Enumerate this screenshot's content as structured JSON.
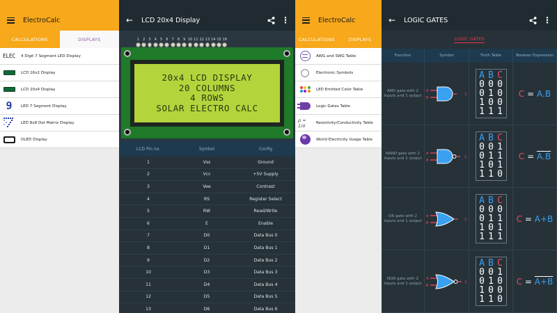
{
  "panel1": {
    "title": "ElectroCalc",
    "tabs": [
      "CALCULATIONS",
      "DISPLAYS"
    ],
    "items": [
      {
        "label": "4 Digit 7 Segment LED Display",
        "icon": "elec-text-icon",
        "icon_text": "ELEC"
      },
      {
        "label": "LCD 16x2 Display",
        "icon": "lcd-small-icon"
      },
      {
        "label": "LCD 20x4 Display",
        "icon": "lcd-small-icon"
      },
      {
        "label": "LED 7 Segment Display",
        "icon": "seven-segment-icon",
        "icon_text": "9"
      },
      {
        "label": "LED 8x8 Dot Matrix Display",
        "icon": "dot-matrix-icon"
      },
      {
        "label": "OLED Display",
        "icon": "oled-icon"
      }
    ]
  },
  "panel2": {
    "title": "LCD 20x4 Display",
    "pin_numbers": [
      "1",
      "2",
      "3",
      "4",
      "5",
      "6",
      "7",
      "8",
      "9",
      "10",
      "11",
      "12",
      "13",
      "14",
      "15",
      "16"
    ],
    "lcd_lines": [
      "20x4 LCD DISPLAY",
      "20 COLUMNS",
      "4 ROWS",
      "SOLAR ELECTRO CALC"
    ],
    "table_headers": [
      "LCD Pin no.",
      "Symbol",
      "Config"
    ],
    "rows": [
      [
        "1",
        "Vss",
        "Ground"
      ],
      [
        "2",
        "Vcc",
        "+5V Supply"
      ],
      [
        "3",
        "Vee",
        "Contrast"
      ],
      [
        "4",
        "RS",
        "Register Select"
      ],
      [
        "5",
        "RW",
        "Read/Write"
      ],
      [
        "6",
        "E",
        "Enable"
      ],
      [
        "7",
        "D0",
        "Data Bus 0"
      ],
      [
        "8",
        "D1",
        "Data Bus 1"
      ],
      [
        "9",
        "D2",
        "Data Bus 2"
      ],
      [
        "10",
        "D3",
        "Data Bus 3"
      ],
      [
        "11",
        "D4",
        "Data Bus 4"
      ],
      [
        "12",
        "D5",
        "Data Bus 5"
      ],
      [
        "13",
        "D6",
        "Data Bus 6"
      ]
    ]
  },
  "panel3": {
    "title": "ElectroCalc",
    "tabs": [
      "CALCULATIONS",
      "DISPLAYS"
    ],
    "items": [
      {
        "label": "AWG and SWG Table",
        "icon": "wire-gauge-icon"
      },
      {
        "label": "Electronic Symbols",
        "icon": "bulb-icon"
      },
      {
        "label": "LED Emitted Color Table",
        "icon": "color-dots-icon"
      },
      {
        "label": "Logic Gates Table",
        "icon": "logic-gate-icon"
      },
      {
        "label": "Resistivity/Conductivity Table",
        "icon": "resistivity-icon",
        "icon_text": "ρ = 1/σ"
      },
      {
        "label": "World Electricity Usage Table",
        "icon": "globe-icon"
      }
    ]
  },
  "panel4": {
    "title": "LOGIC GATES",
    "section_title": "LOGIC GATES",
    "headers": [
      "Function",
      "Symbol",
      "Truth Table",
      "Boolean Expression"
    ],
    "gates": [
      {
        "function": "AND gate with 2 inputs and 1 output",
        "truth_table": [
          "A",
          "B",
          "C",
          "0",
          "0",
          "0",
          "0",
          "1",
          "0",
          "1",
          "0",
          "0",
          "1",
          "1",
          "1"
        ],
        "expr": {
          "out": "C",
          "eq": "=",
          "expr": "A.B",
          "overline": false
        }
      },
      {
        "function": "NAND gate with 2 inputs and 1 output",
        "truth_table": [
          "A",
          "B",
          "C",
          "0",
          "0",
          "1",
          "0",
          "1",
          "1",
          "1",
          "0",
          "1",
          "1",
          "1",
          "0"
        ],
        "expr": {
          "out": "C",
          "eq": "=",
          "expr": "A.B",
          "overline": true
        }
      },
      {
        "function": "OR gate with 2 inputs and 1 output",
        "truth_table": [
          "A",
          "B",
          "C",
          "0",
          "0",
          "0",
          "0",
          "1",
          "1",
          "1",
          "0",
          "1",
          "1",
          "1",
          "1"
        ],
        "expr": {
          "out": "C",
          "eq": "=",
          "expr": "A+B",
          "overline": false
        }
      },
      {
        "function": "NOR gate with 2 inputs and 1 output",
        "truth_table": [
          "A",
          "B",
          "C",
          "0",
          "0",
          "1",
          "0",
          "1",
          "0",
          "1",
          "0",
          "0",
          "1",
          "1",
          "0"
        ],
        "expr": {
          "out": "C",
          "eq": "=",
          "expr": "A+B",
          "overline": true
        }
      }
    ],
    "gate_labels": {
      "a": "A",
      "b": "B",
      "c": "C"
    }
  },
  "colors": {
    "accent": "#f7a81b",
    "highlight": "#e84c64",
    "blue": "#3aa0f0",
    "purple": "#8b5aa8",
    "dark": "#263238"
  }
}
